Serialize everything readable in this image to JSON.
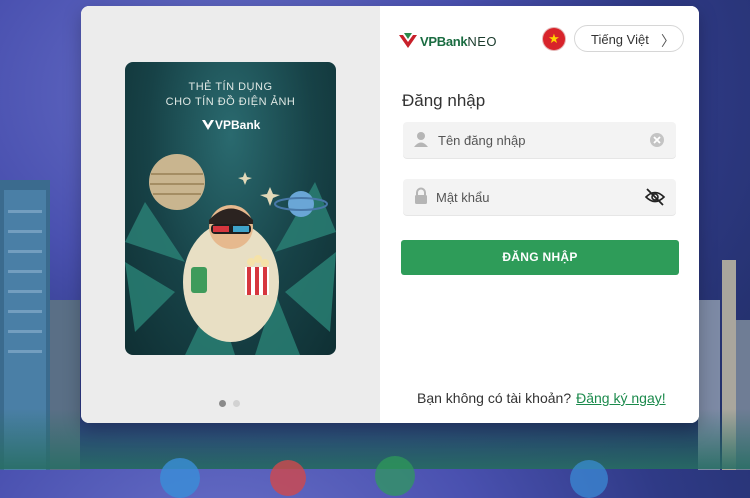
{
  "promo": {
    "line1": "THẺ TÍN DỤNG",
    "line2": "CHO TÍN ĐỒ ĐIỆN ẢNH",
    "brand": "VPBank"
  },
  "carousel": {
    "active_index": 0,
    "count": 2
  },
  "header": {
    "brand_main": "VPBank",
    "brand_sub": "NEO",
    "language_label": "Tiếng Việt",
    "language_flag": "vietnam-flag"
  },
  "login": {
    "title": "Đăng nhập",
    "username_placeholder": "Tên đăng nhập",
    "password_placeholder": "Mật khẩu",
    "submit_label": "ĐĂNG NHẬP"
  },
  "footer": {
    "question": "Bạn không có tài khoản?",
    "signup_link": "Đăng ký ngay!"
  },
  "colors": {
    "primary": "#2e9c59",
    "brand_red": "#d8232a",
    "link": "#1b8a4c"
  }
}
